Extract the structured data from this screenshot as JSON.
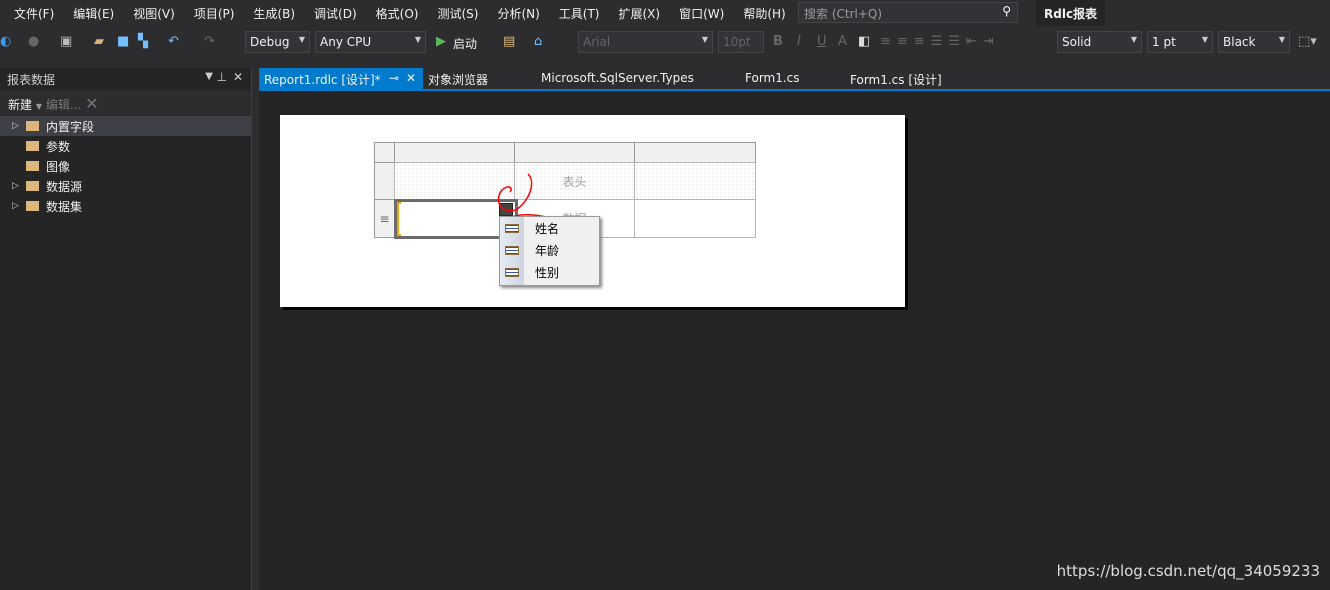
{
  "menu": [
    "文件(F)",
    "编辑(E)",
    "视图(V)",
    "项目(P)",
    "生成(B)",
    "调试(D)",
    "格式(O)",
    "测试(S)",
    "分析(N)",
    "工具(T)",
    "扩展(X)",
    "窗口(W)",
    "帮助(H)"
  ],
  "search": {
    "placeholder": "搜索 (Ctrl+Q)"
  },
  "app_title": "Rdlc报表",
  "toolbar": {
    "config": "Debug",
    "platform": "Any CPU",
    "start": "启动",
    "font": "Arial",
    "size": "10pt",
    "border_style": "Solid",
    "border_width": "1 pt",
    "border_color": "Black"
  },
  "panel": {
    "title": "报表数据",
    "new": "新建",
    "edit": "编辑...",
    "items": [
      {
        "label": "内置字段",
        "expandable": true,
        "selected": true
      },
      {
        "label": "参数",
        "expandable": false
      },
      {
        "label": "图像",
        "expandable": false
      },
      {
        "label": "数据源",
        "expandable": true
      },
      {
        "label": "数据集",
        "expandable": true
      }
    ]
  },
  "tabs": [
    "Report1.rdlc [设计]*",
    "对象浏览器",
    "Microsoft.SqlServer.Types",
    "Form1.cs",
    "Form1.cs [设计]"
  ],
  "report": {
    "header_cell": "表头",
    "data_cell": "数据"
  },
  "field_menu": [
    "姓名",
    "年龄",
    "性别"
  ],
  "watermark": "https://blog.csdn.net/qq_34059233",
  "colors": {
    "accent": "#007acc",
    "annotation": "#ff0000"
  }
}
